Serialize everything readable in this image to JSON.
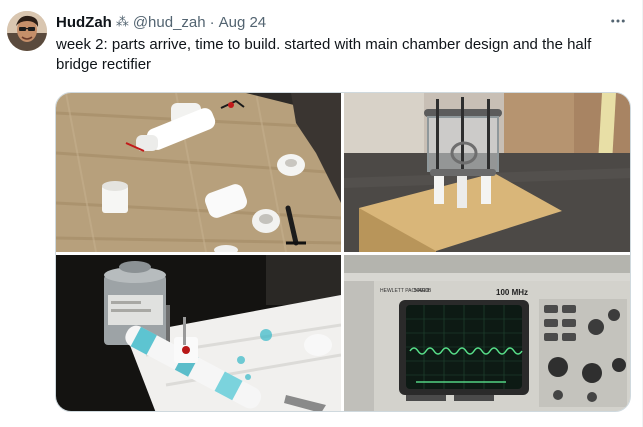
{
  "post": {
    "author": {
      "display_name": "HudZah",
      "badge_glyph": "⁂",
      "handle": "@hud_zah",
      "separator": "·",
      "date": "Aug 24"
    },
    "text": "week 2: parts arrive, time to build. started with main chamber design and the half bridge rectifier",
    "more_icon": "more-horizontal-icon",
    "media": {
      "photos": [
        {
          "name": "pvc-parts-photo"
        },
        {
          "name": "chamber-build-photo"
        },
        {
          "name": "pvc-cement-photo"
        },
        {
          "name": "oscilloscope-photo",
          "label_brand": "HEWLETT PACKARD",
          "label_model": "54600B",
          "label_bandwidth": "100 MHz"
        }
      ]
    }
  },
  "colors": {
    "text_primary": "#0f1419",
    "text_secondary": "#536471",
    "border": "#cfd9de"
  }
}
